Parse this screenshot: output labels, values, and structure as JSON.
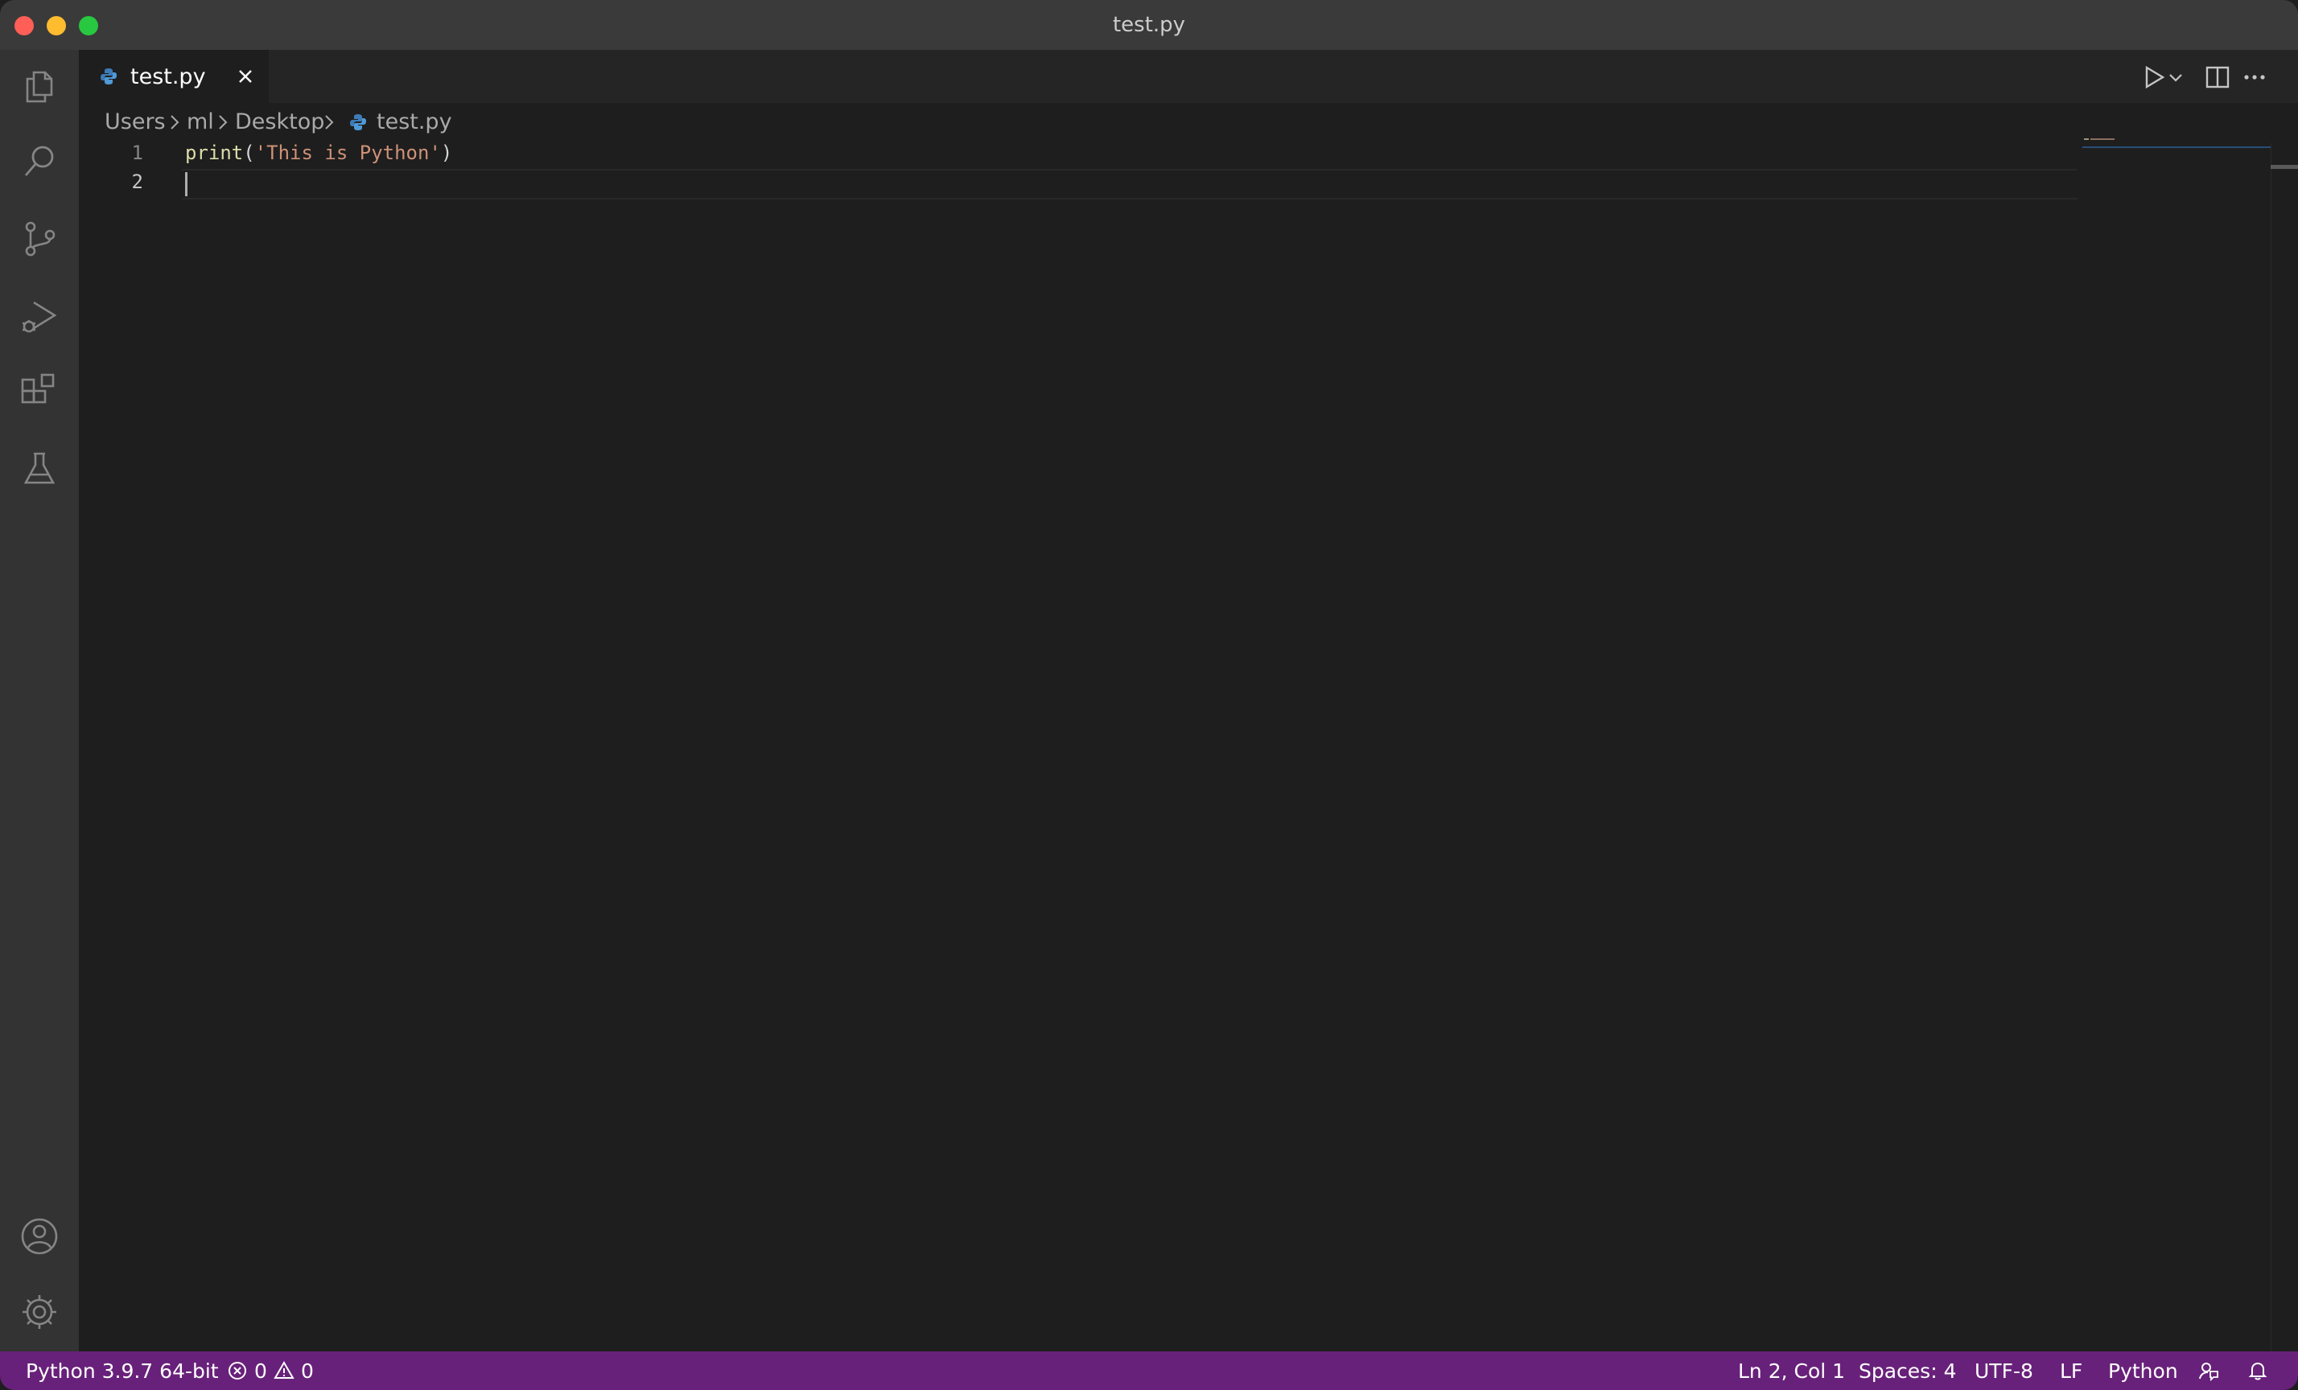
{
  "window": {
    "title": "test.py"
  },
  "tabs": [
    {
      "label": "test.py",
      "icon": "python-icon",
      "close": "close-icon"
    }
  ],
  "breadcrumb": {
    "items": [
      "Users",
      "ml",
      "Desktop",
      "test.py"
    ]
  },
  "editor": {
    "line_numbers": [
      "1",
      "2"
    ],
    "line1": {
      "fn": "print",
      "open": "(",
      "str": "'This is Python'",
      "close": ")"
    },
    "colors": {
      "function": "#dcdcaa",
      "string": "#ce9178",
      "line_number": "#858585"
    }
  },
  "activity_bar": {
    "icons": [
      "explorer-icon",
      "search-icon",
      "source-control-icon",
      "run-debug-icon",
      "extensions-icon",
      "testing-icon",
      "account-icon",
      "gear-icon"
    ]
  },
  "statusbar": {
    "interpreter": "Python 3.9.7 64-bit",
    "errors": "0",
    "warnings": "0",
    "position": "Ln 2, Col 1",
    "spaces": "Spaces: 4",
    "encoding": "UTF-8",
    "eol": "LF",
    "language": "Python",
    "color": "#68217a"
  }
}
